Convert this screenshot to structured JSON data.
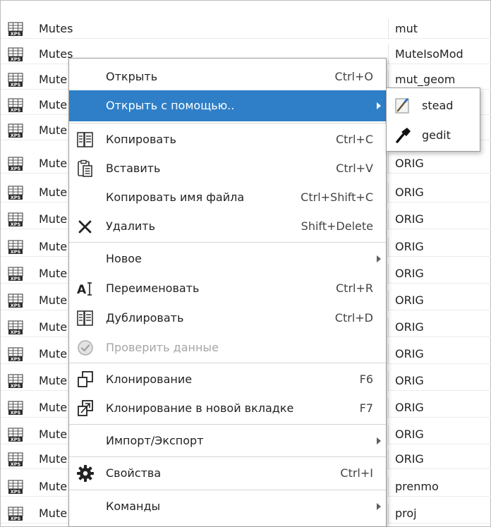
{
  "file_list": {
    "rows": [
      {
        "name": "Mutes",
        "type": "mut"
      },
      {
        "name": "Mutes",
        "type": "MuteIsoMod"
      },
      {
        "name": "Mute",
        "type": "mut_geom"
      },
      {
        "name": "Mute",
        "type": ""
      },
      {
        "name": "Mute",
        "type": ""
      },
      {
        "name": "Mute",
        "type": "ORIG"
      },
      {
        "name": "Mute",
        "type": "ORIG"
      },
      {
        "name": "Mute",
        "type": "ORIG"
      },
      {
        "name": "Mute",
        "type": "ORIG"
      },
      {
        "name": "Mute",
        "type": "ORIG"
      },
      {
        "name": "Mute",
        "type": "ORIG"
      },
      {
        "name": "Mute",
        "type": "ORIG"
      },
      {
        "name": "Mute",
        "type": "ORIG"
      },
      {
        "name": "Mute",
        "type": "ORIG"
      },
      {
        "name": "Mute",
        "type": "ORIG"
      },
      {
        "name": "Mute",
        "type": "ORIG"
      },
      {
        "name": "Mute",
        "type": "ORIG"
      },
      {
        "name": "Mute",
        "type": "prenmo"
      },
      {
        "name": "Mute",
        "type": "proj"
      }
    ],
    "file_icon": "xps-file-icon",
    "icon_badge": "XPS"
  },
  "context_menu": {
    "items": [
      {
        "label": "Открыть",
        "shortcut": "Ctrl+O",
        "icon": ""
      },
      {
        "label": "Открыть с помощью..",
        "shortcut": "",
        "icon": "",
        "submenu": true,
        "highlighted": true
      },
      {
        "label": "Копировать",
        "shortcut": "Ctrl+C",
        "icon": "copy-icon"
      },
      {
        "label": "Вставить",
        "shortcut": "Ctrl+V",
        "icon": "paste-icon"
      },
      {
        "label": "Копировать имя файла",
        "shortcut": "Ctrl+Shift+C",
        "icon": ""
      },
      {
        "label": "Удалить",
        "shortcut": "Shift+Delete",
        "icon": "delete-icon"
      },
      {
        "label": "Новое",
        "shortcut": "",
        "icon": "",
        "submenu": true
      },
      {
        "label": "Переименовать",
        "shortcut": "Ctrl+R",
        "icon": "rename-icon"
      },
      {
        "label": "Дублировать",
        "shortcut": "Ctrl+D",
        "icon": "duplicate-icon"
      },
      {
        "label": "Проверить данные",
        "shortcut": "",
        "icon": "check-data-icon",
        "disabled": true
      },
      {
        "label": "Клонирование",
        "shortcut": "F6",
        "icon": "clone-icon"
      },
      {
        "label": "Клонирование в новой вкладке",
        "shortcut": "F7",
        "icon": "clone-new-tab-icon"
      },
      {
        "label": "Импорт/Экспорт",
        "shortcut": "",
        "icon": "",
        "submenu": true
      },
      {
        "label": "Свойства",
        "shortcut": "Ctrl+I",
        "icon": "gear-icon"
      },
      {
        "label": "Команды",
        "shortcut": "",
        "icon": "",
        "submenu": true
      }
    ]
  },
  "submenu": {
    "items": [
      {
        "label": "stead",
        "icon": "stead-app-icon"
      },
      {
        "label": "gedit",
        "icon": "gedit-app-icon"
      }
    ]
  },
  "colors": {
    "highlight": "#2f7fc8",
    "disabled_text": "#a5a5a5"
  }
}
